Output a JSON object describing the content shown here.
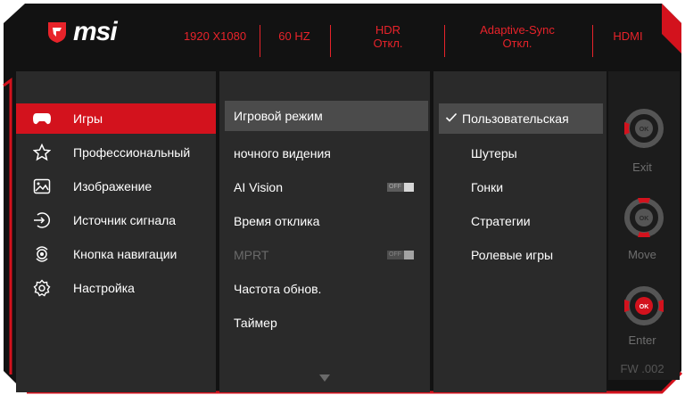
{
  "brand": "msi",
  "header": {
    "resolution": "1920 X1080",
    "refresh": "60 HZ",
    "hdr_label": "HDR",
    "hdr_value": "Откл.",
    "adaptive_label": "Adaptive-Sync",
    "adaptive_value": "Откл.",
    "input": "HDMI"
  },
  "menu": [
    {
      "label": "Игры",
      "icon": "gamepad-icon",
      "active": true
    },
    {
      "label": "Профессиональный",
      "icon": "star-icon"
    },
    {
      "label": "Изображение",
      "icon": "image-icon"
    },
    {
      "label": "Источник сигнала",
      "icon": "input-source-icon"
    },
    {
      "label": "Кнопка навигации",
      "icon": "navigation-key-icon"
    },
    {
      "label": "Настройка",
      "icon": "settings-gear-icon"
    }
  ],
  "submenu": [
    {
      "label": "Игровой режим",
      "active": true
    },
    {
      "label": "ночного видения"
    },
    {
      "label": "AI Vision",
      "toggle": "OFF"
    },
    {
      "label": "Время отклика"
    },
    {
      "label": "MPRT",
      "toggle": "OFF",
      "disabled": true
    },
    {
      "label": "Частота обнов."
    },
    {
      "label": "Таймер"
    }
  ],
  "options": [
    {
      "label": "Пользовательская",
      "selected": true
    },
    {
      "label": "Шутеры"
    },
    {
      "label": "Гонки"
    },
    {
      "label": "Стратегии"
    },
    {
      "label": "Ролевые игры"
    }
  ],
  "nav": {
    "exit_label": "Exit",
    "move_label": "Move",
    "enter_label": "Enter",
    "ok": "OK",
    "firmware": "FW .002"
  },
  "colors": {
    "accent": "#d3121d",
    "panel": "#2a2a2a",
    "background": "#121212",
    "highlight": "#4b4b4b"
  }
}
